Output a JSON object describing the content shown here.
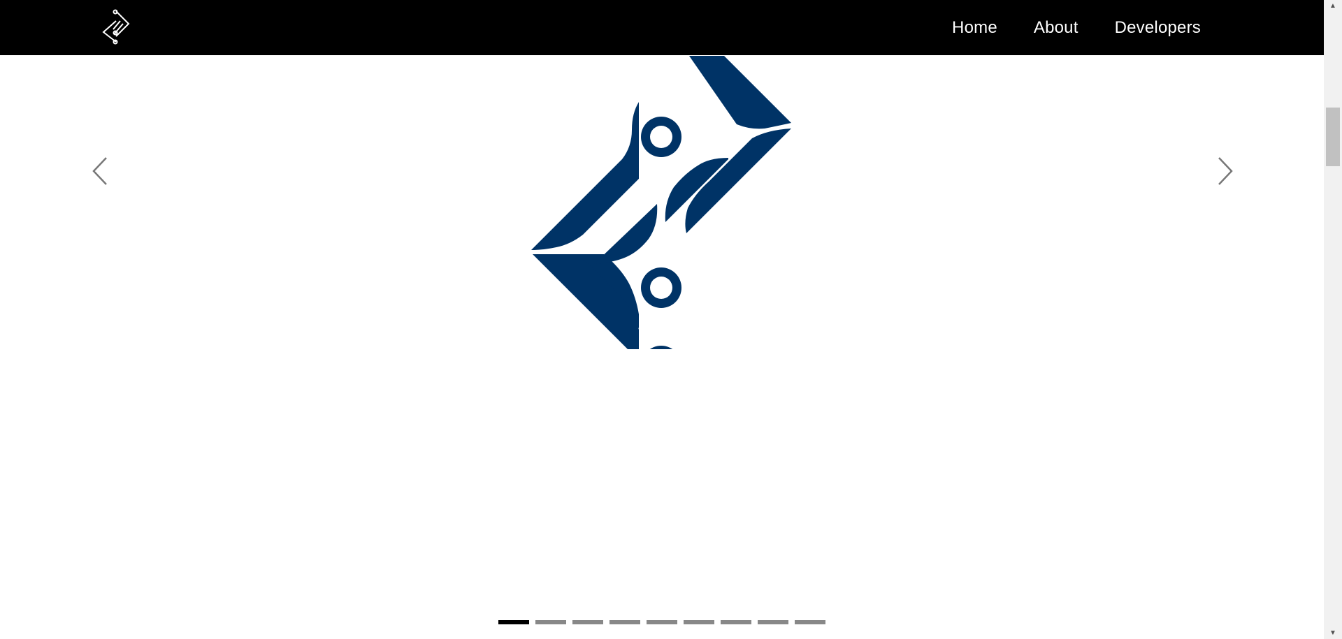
{
  "navbar": {
    "brand_icon": "chip-diamond-logo-icon",
    "links": [
      {
        "label": "Home"
      },
      {
        "label": "About"
      },
      {
        "label": "Developers"
      }
    ]
  },
  "carousel": {
    "slide_logo_icon": "chip-diamond-logo-icon",
    "prev_icon": "chevron-left-icon",
    "next_icon": "chevron-right-icon",
    "slide_count": 9,
    "active_slide": 1
  },
  "colors": {
    "navbar_bg": "#000000",
    "logo_primary": "#003366",
    "indicator_active": "#000000",
    "indicator_inactive": "#888888"
  }
}
